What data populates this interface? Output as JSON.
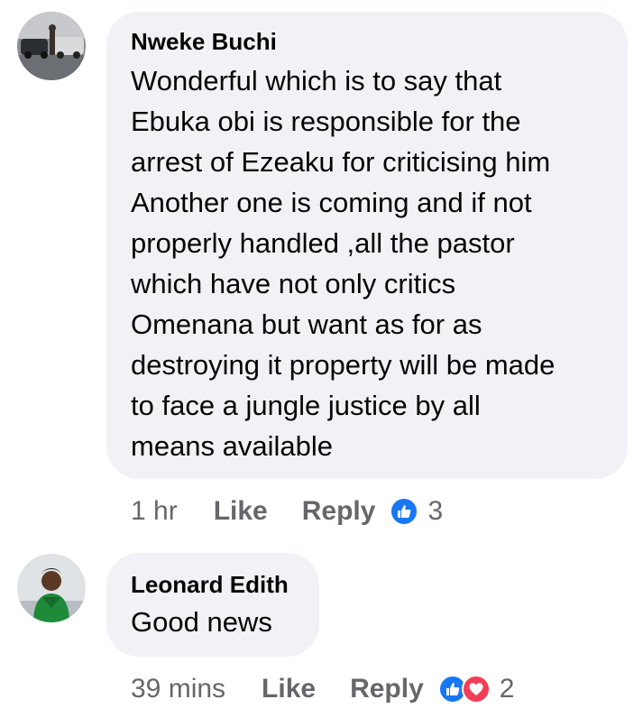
{
  "comments": [
    {
      "author": "Nweke Buchi",
      "avatar_icon": "profile-photo-cars",
      "text_lines": [
        "Wonderful which is to say that",
        "Ebuka obi is responsible for the",
        "arrest of Ezeaku for criticising him",
        "Another one is coming and if not",
        "properly handled ,all the pastor",
        "which have not only critics",
        "Omenana but want as for as",
        "destroying  it property will be made",
        "to face a jungle justice by all",
        "means available"
      ],
      "time": "1 hr",
      "like_label": "Like",
      "reply_label": "Reply",
      "reactions": [
        "like"
      ],
      "reaction_count": "3"
    },
    {
      "author": "Leonard Edith",
      "avatar_icon": "profile-photo-woman-green-dress",
      "text_lines": [
        "Good news"
      ],
      "time": "39 mins",
      "like_label": "Like",
      "reply_label": "Reply",
      "reactions": [
        "like",
        "love"
      ],
      "reaction_count": "2"
    }
  ],
  "colors": {
    "bubble": "#f0f2f5",
    "meta_text": "#65676b",
    "like_blue": "#1877f2",
    "love_red": "#f33e58"
  }
}
